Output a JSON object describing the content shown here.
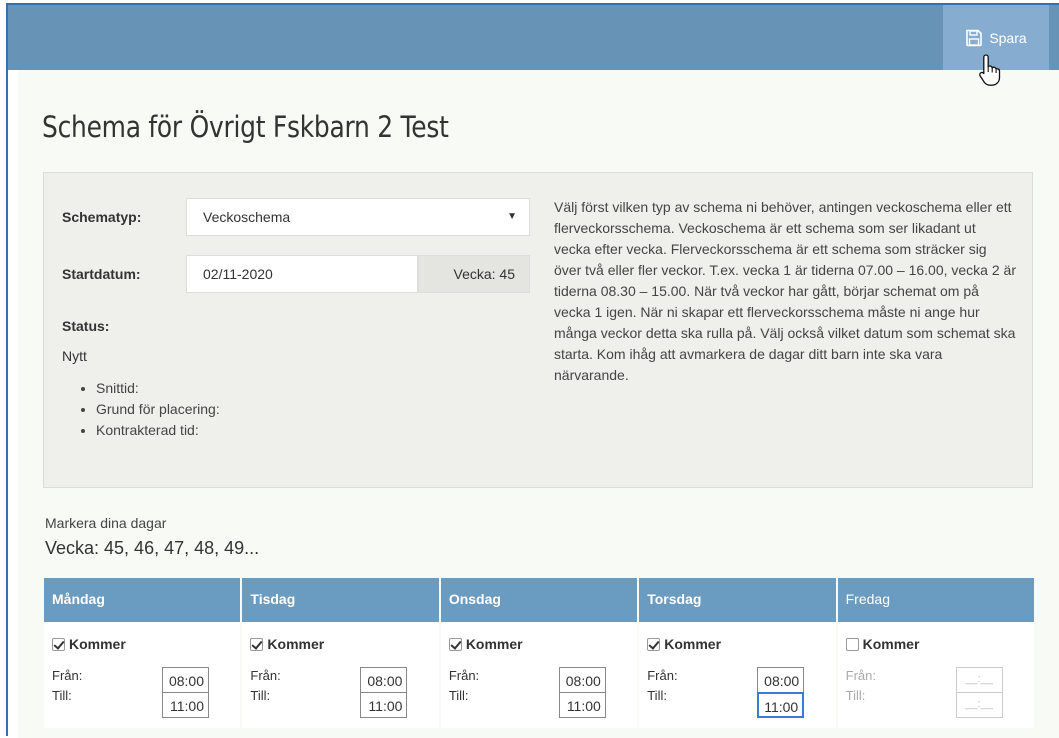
{
  "toolbar": {
    "save_label": "Spara",
    "save_icon": "floppy-disk-icon"
  },
  "page": {
    "title": "Schema för Övrigt Fskbarn 2 Test"
  },
  "form": {
    "schematyp_label": "Schematyp:",
    "schematyp_value": "Veckoschema",
    "startdatum_label": "Startdatum:",
    "startdatum_value": "02/11-2020",
    "vecka_addon": "Vecka: 45",
    "status_label": "Status:",
    "status_value": "Nytt",
    "info_items": [
      "Snittid:",
      "Grund för placering:",
      "Kontrakterad tid:"
    ]
  },
  "help_text": "Välj först vilken typ av schema ni behöver, antingen veckoschema eller ett flerveckorsschema. Veckoschema är ett schema som ser likadant ut vecka efter vecka. Flerveckorsschema är ett schema som sträcker sig över två eller fler veckor. T.ex. vecka 1 är tiderna 07.00 – 16.00, vecka 2 är tiderna 08.30 – 15.00. När två veckor har gått, börjar schemat om på vecka 1 igen. När ni skapar ett flerveckorsschema måste ni ange hur många veckor detta ska rulla på. Välj också vilket datum som schemat ska starta. Kom ihåg att avmarkera de dagar ditt barn inte ska vara närvarande.",
  "schedule": {
    "mark_label": "Markera dina dagar",
    "weeks": "Vecka: 45, 46, 47, 48, 49...",
    "kommer_label": "Kommer",
    "from_label": "Från:",
    "to_label": "Till:",
    "days": [
      {
        "name": "Måndag",
        "checked": true,
        "from": "08:00",
        "to": "11:00"
      },
      {
        "name": "Tisdag",
        "checked": true,
        "from": "08:00",
        "to": "11:00"
      },
      {
        "name": "Onsdag",
        "checked": true,
        "from": "08:00",
        "to": "11:00"
      },
      {
        "name": "Torsdag",
        "checked": true,
        "from": "08:00",
        "to": "11:00"
      },
      {
        "name": "Fredag",
        "checked": false,
        "from": "__:__",
        "to": "__:__"
      }
    ]
  },
  "colors": {
    "topbar": "#6794b6",
    "save_button": "#86add0",
    "day_header": "#6a9bc0",
    "panel": "#efefeb"
  }
}
